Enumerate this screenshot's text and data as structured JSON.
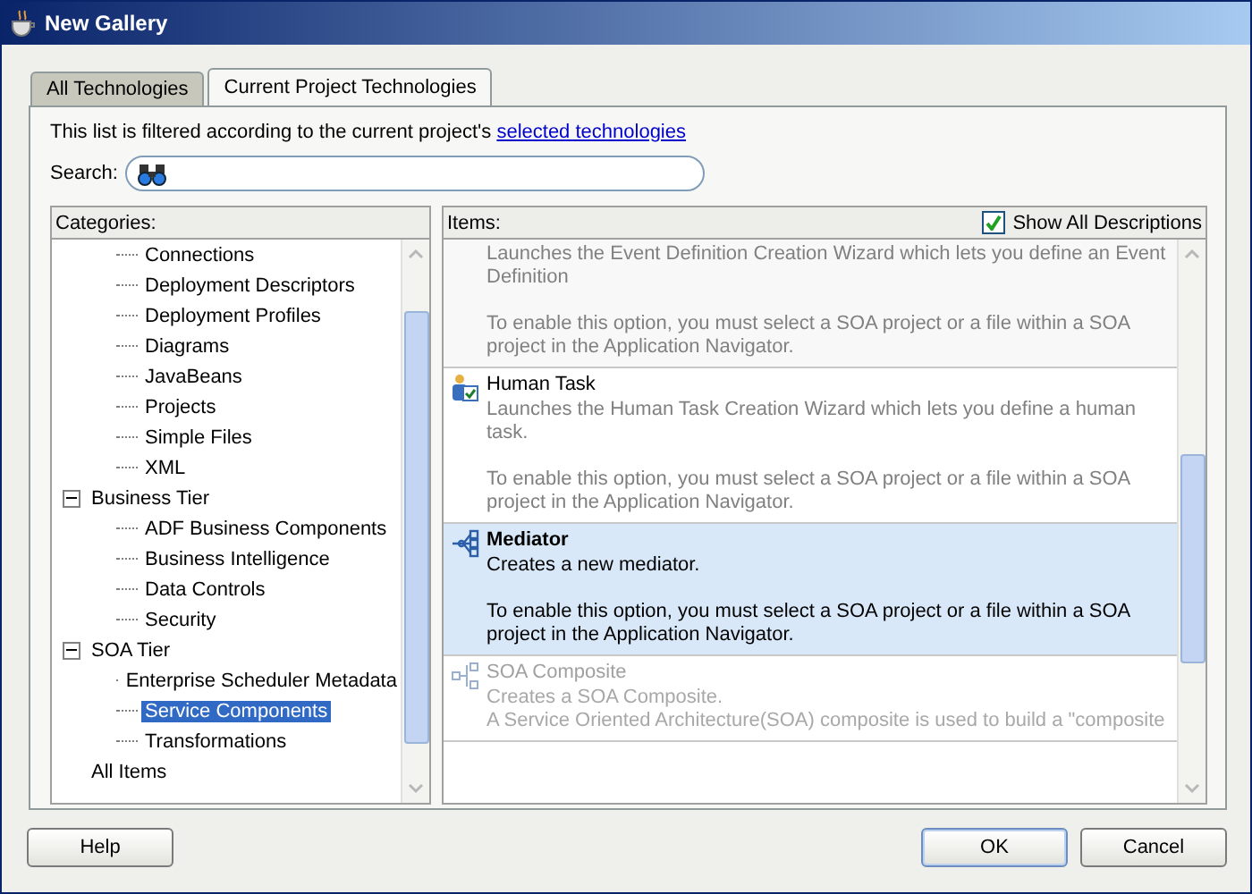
{
  "window": {
    "title": "New Gallery"
  },
  "tabs": [
    {
      "label": "All Technologies",
      "selected": false
    },
    {
      "label": "Current Project Technologies",
      "selected": true
    }
  ],
  "filter_note": {
    "text": "This list is filtered according to the current project's ",
    "link": "selected technologies"
  },
  "search": {
    "label": "Search:"
  },
  "categories": {
    "label": "Categories:",
    "items": [
      {
        "children": [
          {
            "label": "Connections",
            "selected": false
          },
          {
            "label": "Deployment Descriptors",
            "selected": false
          },
          {
            "label": "Deployment Profiles",
            "selected": false
          },
          {
            "label": "Diagrams",
            "selected": false
          },
          {
            "label": "JavaBeans",
            "selected": false
          },
          {
            "label": "Projects",
            "selected": false
          },
          {
            "label": "Simple Files",
            "selected": false
          },
          {
            "label": "XML",
            "selected": false
          }
        ]
      },
      {
        "label": "Business Tier",
        "expanded": true,
        "selected": false,
        "children": [
          {
            "label": "ADF Business Components",
            "selected": false
          },
          {
            "label": "Business Intelligence",
            "selected": false
          },
          {
            "label": "Data Controls",
            "selected": false
          },
          {
            "label": "Security",
            "selected": false
          }
        ]
      },
      {
        "label": "SOA Tier",
        "expanded": true,
        "selected": false,
        "children": [
          {
            "label": "Enterprise Scheduler Metadata",
            "selected": false
          },
          {
            "label": "Service Components",
            "selected": true
          },
          {
            "label": "Transformations",
            "selected": false
          }
        ]
      },
      {
        "label": "All Items",
        "selected": false
      }
    ]
  },
  "items": {
    "label": "Items:",
    "show_all_descriptions": {
      "label": "Show All Descriptions",
      "checked": true
    },
    "list": [
      {
        "kind": "none",
        "selected": false,
        "disabled": false,
        "description": [
          "Launches the Event Definition Creation Wizard which lets you define an Event Definition",
          "To enable this option, you must select a SOA project or a file within a SOA project in the Application Navigator."
        ]
      },
      {
        "kind": "task",
        "name": "Human Task",
        "selected": false,
        "disabled": false,
        "description": [
          "Launches the Human Task Creation Wizard which lets you define a human task.",
          "To enable this option, you must select a SOA project or a file within a SOA project in the Application Navigator."
        ]
      },
      {
        "kind": "mediator",
        "name": "Mediator",
        "selected": true,
        "disabled": false,
        "description": [
          "Creates a new mediator.",
          "To enable this option, you must select a SOA project or a file within a SOA project in the Application Navigator."
        ]
      },
      {
        "kind": "composite",
        "name": "SOA Composite",
        "selected": false,
        "disabled": true,
        "description": [
          "Creates a SOA Composite.\nA Service Oriented Architecture(SOA) composite is used to build a \"composite"
        ]
      }
    ]
  },
  "buttons": [
    {
      "label": "Help",
      "default": false
    },
    {
      "label": "OK",
      "default": true
    },
    {
      "label": "Cancel",
      "default": false
    }
  ]
}
